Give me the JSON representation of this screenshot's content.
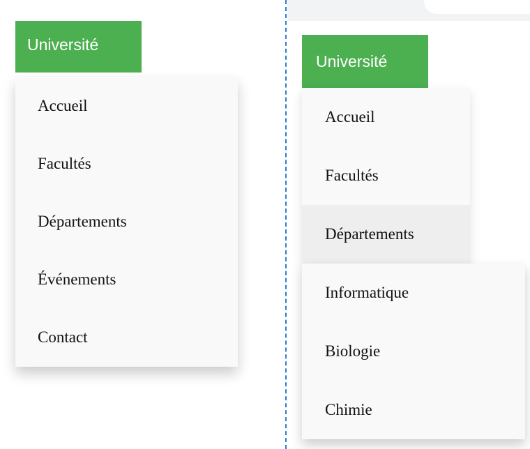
{
  "left_panel": {
    "brand_label": "Université",
    "menu": [
      {
        "label": "Accueil"
      },
      {
        "label": "Facultés"
      },
      {
        "label": "Départements"
      },
      {
        "label": "Événements"
      },
      {
        "label": "Contact"
      }
    ]
  },
  "right_panel": {
    "brand_label": "Université",
    "menu": [
      {
        "label": "Accueil"
      },
      {
        "label": "Facultés"
      },
      {
        "label": "Départements",
        "state": "hovered"
      }
    ],
    "submenu": [
      {
        "label": "Informatique"
      },
      {
        "label": "Biologie"
      },
      {
        "label": "Chimie"
      }
    ]
  },
  "colors": {
    "brand_green": "#4caf50",
    "menu_bg": "#f9f9f9",
    "hover_bg": "#eeeeee",
    "divider_blue": "#2b7bd6"
  }
}
